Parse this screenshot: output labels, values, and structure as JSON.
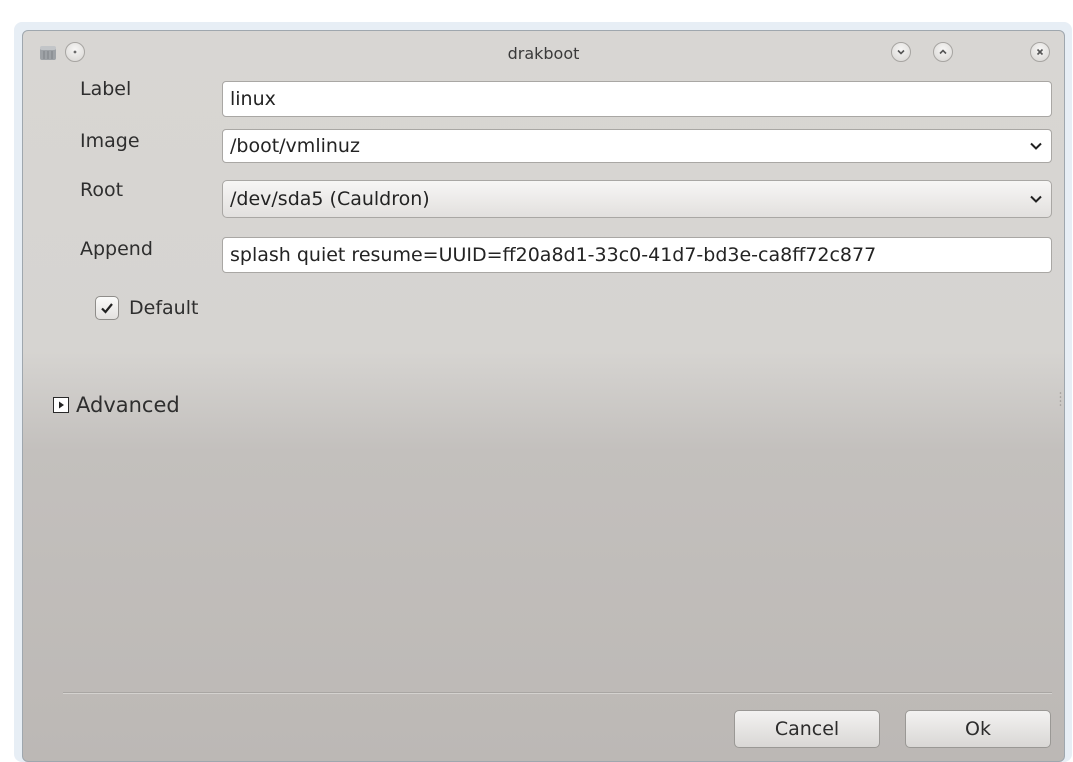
{
  "window": {
    "title": "drakboot",
    "icons": {
      "app": "drive-icon",
      "menu": "window-menu-icon",
      "minimize": "minimize-icon",
      "maximize": "maximize-icon",
      "close": "close-icon"
    }
  },
  "form": {
    "label": {
      "caption": "Label",
      "value": "linux"
    },
    "image": {
      "caption": "Image",
      "value": "/boot/vmlinuz"
    },
    "root": {
      "caption": "Root",
      "value": "/dev/sda5 (Cauldron)"
    },
    "append": {
      "caption": "Append",
      "value": "splash quiet resume=UUID=ff20a8d1-33c0-41d7-bd3e-ca8ff72c877"
    },
    "default": {
      "caption": "Default",
      "checked": true
    }
  },
  "advanced": {
    "label": "Advanced",
    "expanded": false
  },
  "buttons": {
    "cancel": "Cancel",
    "ok": "Ok"
  }
}
